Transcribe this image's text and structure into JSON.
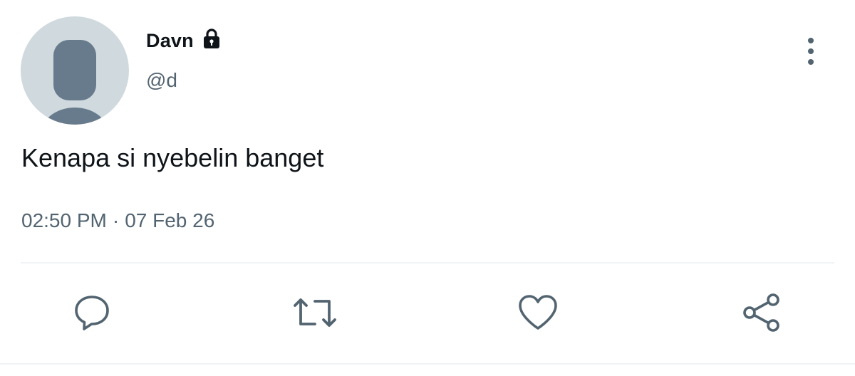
{
  "author": {
    "display_name": "Davn",
    "handle": "@d",
    "protected": true,
    "avatar_icon": "default-avatar-silhouette"
  },
  "tweet": {
    "text": "Kenapa si nyebelin banget",
    "time": "02:50 PM",
    "separator": "·",
    "date": "07 Feb 26"
  },
  "icons": {
    "lock": "lock-icon",
    "more": "more-vertical-icon",
    "reply": "reply-icon",
    "retweet": "retweet-icon",
    "like": "heart-icon",
    "share": "share-icon"
  },
  "colors": {
    "text_primary": "#0f1419",
    "text_secondary": "#536471",
    "icon": "#536471",
    "avatar_bg": "#cfd9de",
    "avatar_figure": "#687b8c",
    "divider": "#eff3f4"
  }
}
